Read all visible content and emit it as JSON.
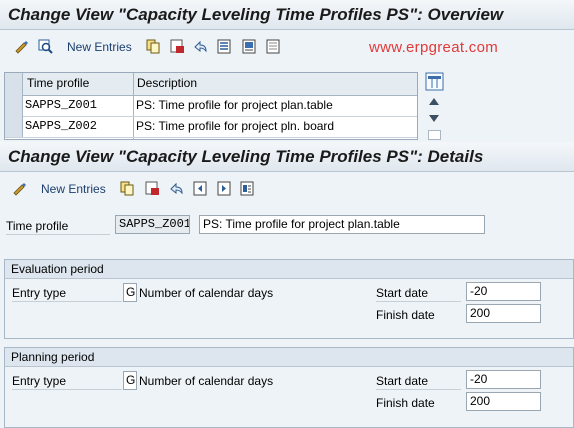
{
  "overview": {
    "title": "Change View \"Capacity Leveling Time Profiles PS\": Overview",
    "toolbar": {
      "new_entries": "New Entries"
    },
    "watermark": "www.erpgreat.com",
    "table": {
      "columns": [
        "Time profile",
        "Description"
      ],
      "rows": [
        {
          "profile": "SAPPS_Z001",
          "description": "PS: Time profile for project plan.table"
        },
        {
          "profile": "SAPPS_Z002",
          "description": "PS: Time profile for project pln. board"
        }
      ]
    }
  },
  "details": {
    "title": "Change View \"Capacity Leveling Time Profiles PS\": Details",
    "toolbar": {
      "new_entries": "New Entries"
    },
    "time_profile_label": "Time profile",
    "time_profile_value": "SAPPS_Z001",
    "time_profile_desc": "PS: Time profile for project plan.table",
    "evaluation": {
      "header": "Evaluation period",
      "entry_type_label": "Entry type",
      "entry_type_value": "G",
      "entry_type_text": "Number of calendar days",
      "start_label": "Start date",
      "start_value": "-20",
      "finish_label": "Finish date",
      "finish_value": "200"
    },
    "planning": {
      "header": "Planning period",
      "entry_type_label": "Entry type",
      "entry_type_value": "G",
      "entry_type_text": "Number of calendar days",
      "start_label": "Start date",
      "start_value": "-20",
      "finish_label": "Finish date",
      "finish_value": "200"
    }
  },
  "colors": {
    "link_blue": "#1c3f6e",
    "watermark_red": "#e13a3a",
    "panel_bg": "#eef3f7"
  }
}
